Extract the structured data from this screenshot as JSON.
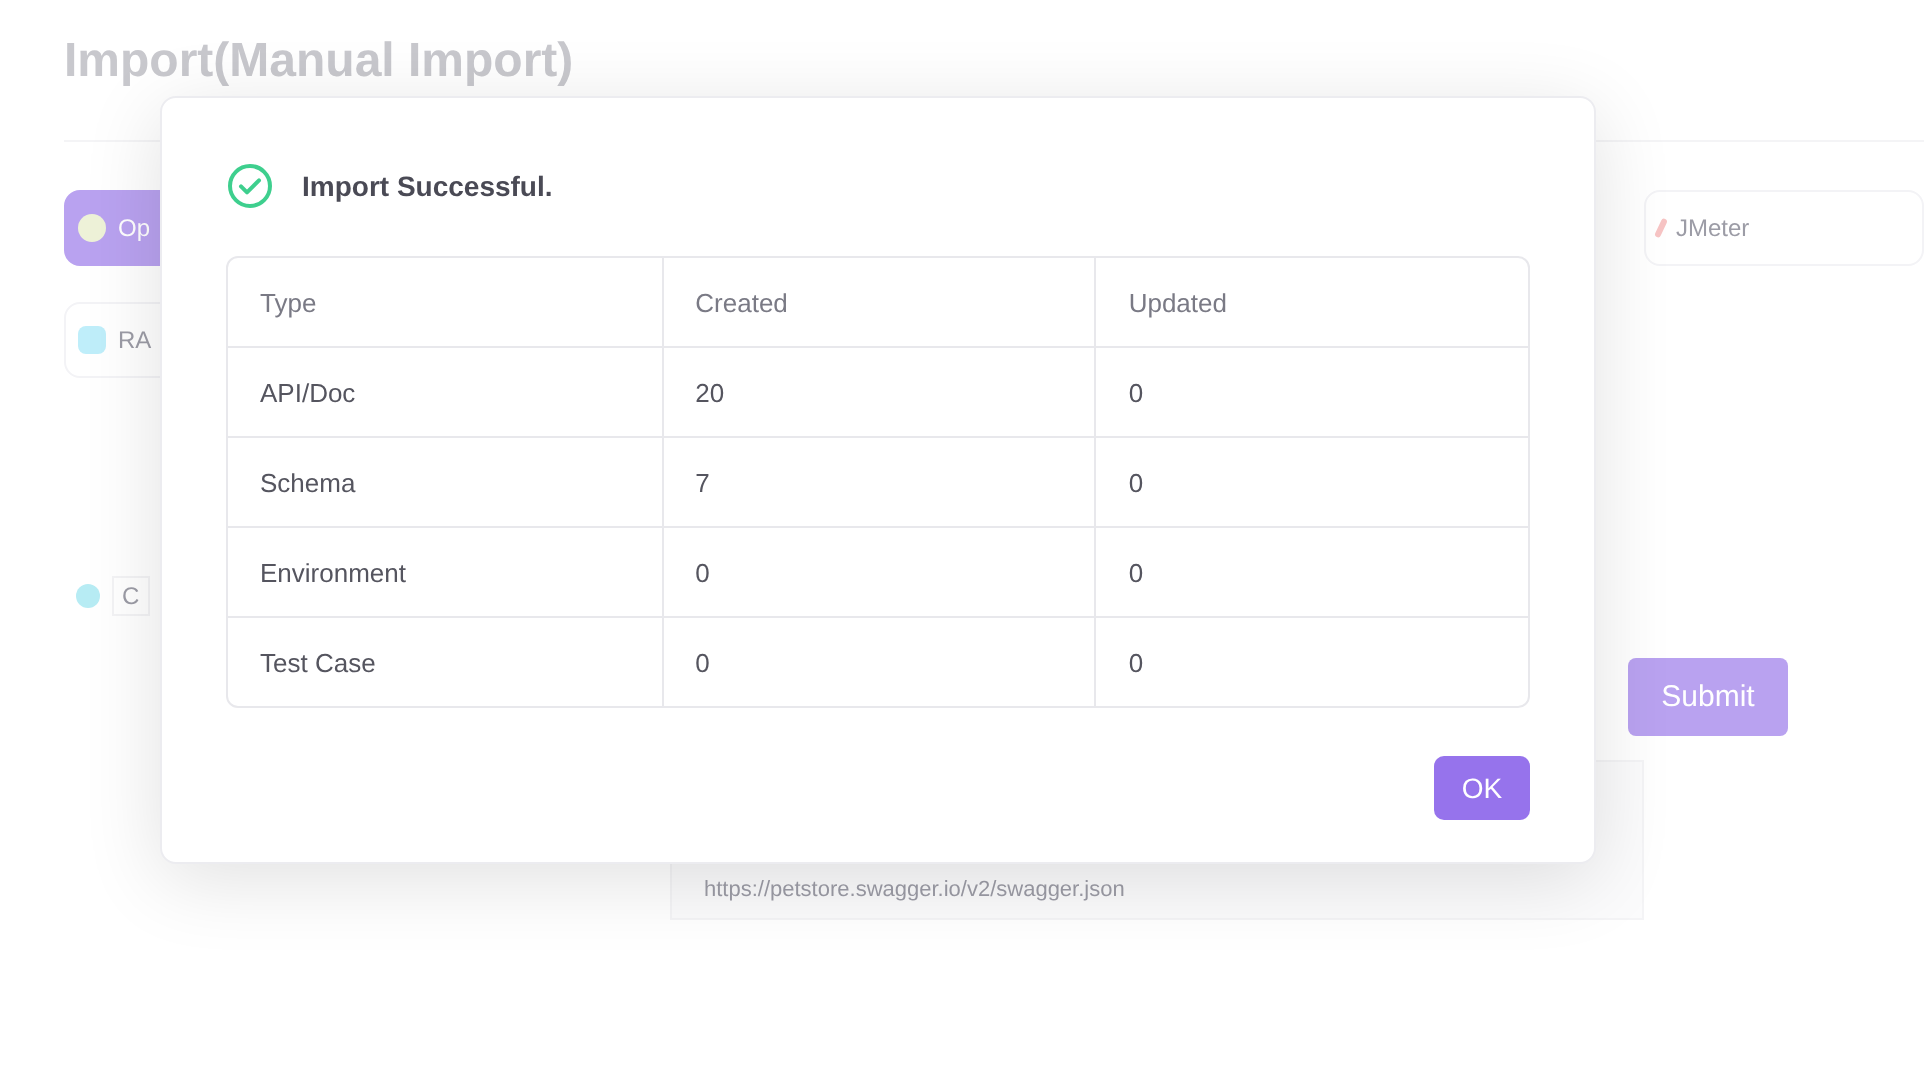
{
  "page": {
    "title": "Import(Manual Import)",
    "sources": [
      {
        "label": "Op",
        "selected": true
      },
      {
        "label": "JMeter",
        "selected": false
      },
      {
        "label": "RA",
        "selected": false
      }
    ],
    "info": "C",
    "submit": "Submit",
    "url": "https://petstore.swagger.io/v2/swagger.json"
  },
  "dialog": {
    "message": "Import Successful.",
    "table": {
      "columns": [
        "Type",
        "Created",
        "Updated"
      ],
      "rows": [
        [
          "API/Doc",
          "20",
          "0"
        ],
        [
          "Schema",
          "7",
          "0"
        ],
        [
          "Environment",
          "0",
          "0"
        ],
        [
          "Test Case",
          "0",
          "0"
        ]
      ]
    },
    "ok": "OK"
  }
}
